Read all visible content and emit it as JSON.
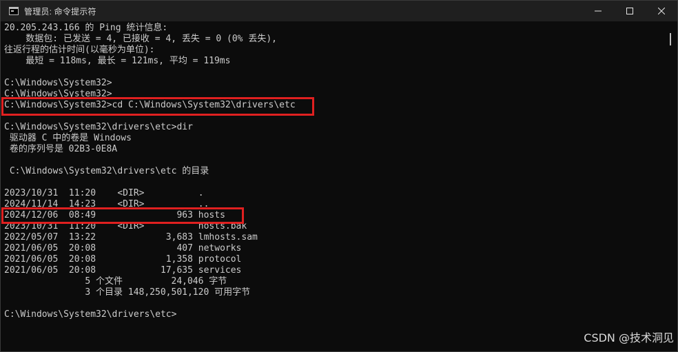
{
  "window": {
    "title": "管理员: 命令提示符",
    "icon": "console-icon"
  },
  "controls": {
    "minimize": "minimize-icon",
    "maximize": "maximize-icon",
    "close": "close-icon"
  },
  "console": {
    "lines": [
      "20.205.243.166 的 Ping 统计信息:",
      "    数据包: 已发送 = 4, 已接收 = 4, 丢失 = 0 (0% 丢失),",
      "往返行程的估计时间(以毫秒为单位):",
      "    最短 = 118ms, 最长 = 121ms, 平均 = 119ms",
      "",
      "C:\\Windows\\System32>",
      "C:\\Windows\\System32>",
      "C:\\Windows\\System32>cd C:\\Windows\\System32\\drivers\\etc",
      "",
      "C:\\Windows\\System32\\drivers\\etc>dir",
      " 驱动器 C 中的卷是 Windows",
      " 卷的序列号是 02B3-0E8A",
      "",
      " C:\\Windows\\System32\\drivers\\etc 的目录",
      "",
      "2023/10/31  11:20    <DIR>          .",
      "2024/11/14  14:23    <DIR>          ..",
      "2024/12/06  08:49               963 hosts",
      "2023/10/31  11:20    <DIR>          hosts.bak",
      "2022/05/07  13:22             3,683 lmhosts.sam",
      "2021/06/05  20:08               407 networks",
      "2021/06/05  20:08             1,358 protocol",
      "2021/06/05  20:08            17,635 services",
      "               5 个文件         24,046 字节",
      "               3 个目录 148,250,501,120 可用字节",
      "",
      "C:\\Windows\\System32\\drivers\\etc>"
    ]
  },
  "annotations": {
    "highlight_color": "#e02020",
    "watermark": "CSDN @技术洞见"
  }
}
